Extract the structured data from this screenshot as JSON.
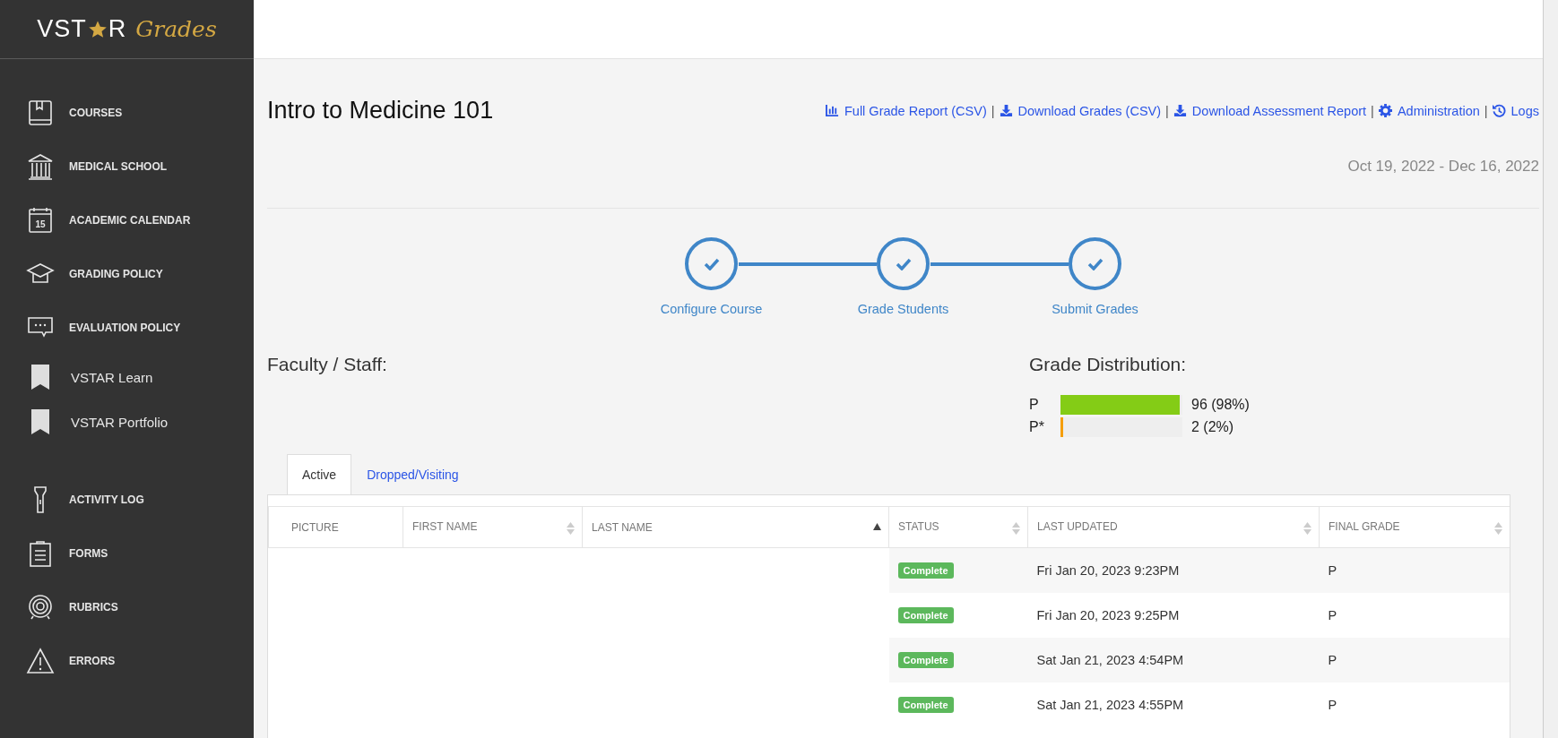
{
  "logo": {
    "prefix": "VST",
    "suffix": "R",
    "script": "Grades"
  },
  "sidebar": {
    "items": [
      {
        "kind": "nav",
        "label": "COURSES"
      },
      {
        "kind": "nav",
        "label": "MEDICAL SCHOOL"
      },
      {
        "kind": "nav",
        "label": "ACADEMIC CALENDAR",
        "icon_text": "15"
      },
      {
        "kind": "nav",
        "label": "GRADING POLICY"
      },
      {
        "kind": "nav",
        "label": "EVALUATION POLICY"
      },
      {
        "kind": "link",
        "label": "VSTAR Learn"
      },
      {
        "kind": "link",
        "label": "VSTAR Portfolio"
      },
      {
        "kind": "nav",
        "label": "ACTIVITY LOG"
      },
      {
        "kind": "nav",
        "label": "FORMS"
      },
      {
        "kind": "nav",
        "label": "RUBRICS"
      },
      {
        "kind": "nav",
        "label": "ERRORS"
      }
    ]
  },
  "course": {
    "title": "Intro to Medicine 101",
    "dates": "Oct 19, 2022 - Dec 16, 2022"
  },
  "actions": [
    {
      "kind": "chart",
      "label": "Full Grade Report (CSV)",
      "separator": "|"
    },
    {
      "kind": "download",
      "label": "Download Grades (CSV)",
      "separator": "|"
    },
    {
      "kind": "download",
      "label": "Download Assessment Report",
      "separator": "|"
    },
    {
      "kind": "settings",
      "label": "Administration",
      "separator": "|"
    },
    {
      "kind": "history",
      "label": "Logs"
    }
  ],
  "steps": [
    {
      "label": "Configure Course",
      "done": true
    },
    {
      "label": "Grade Students",
      "done": true
    },
    {
      "label": "Submit Grades",
      "done": true
    }
  ],
  "faculty": {
    "heading": "Faculty / Staff:"
  },
  "grade_distribution": {
    "heading": "Grade Distribution:",
    "grades": [
      {
        "grade": "P",
        "level": 0.98,
        "count": "96 (98%)",
        "color": "#84cc16"
      },
      {
        "grade": "P*",
        "level": 0.02,
        "count": "2 (2%)",
        "color": "#f59e0b"
      }
    ]
  },
  "tabs": [
    {
      "label": "Active",
      "selected": true
    },
    {
      "label": "Dropped/Visiting",
      "selected": false
    }
  ],
  "table": {
    "columns": [
      {
        "label": "PICTURE"
      },
      {
        "label": "FIRST NAME",
        "sorted": false
      },
      {
        "label": "LAST NAME",
        "sorted": true
      },
      {
        "label": "STATUS",
        "sorted": false
      },
      {
        "label": "LAST UPDATED",
        "sorted": false
      },
      {
        "label": "FINAL GRADE",
        "sorted": false
      }
    ],
    "rows": [
      {
        "status": "Complete",
        "last_updated": "Fri Jan 20, 2023 9:23PM",
        "final_grade": "P"
      },
      {
        "status": "Complete",
        "last_updated": "Fri Jan 20, 2023 9:25PM",
        "final_grade": "P"
      },
      {
        "status": "Complete",
        "last_updated": "Sat Jan 21, 2023 4:54PM",
        "final_grade": "P"
      },
      {
        "status": "Complete",
        "last_updated": "Sat Jan 21, 2023 4:55PM",
        "final_grade": "P"
      }
    ]
  }
}
